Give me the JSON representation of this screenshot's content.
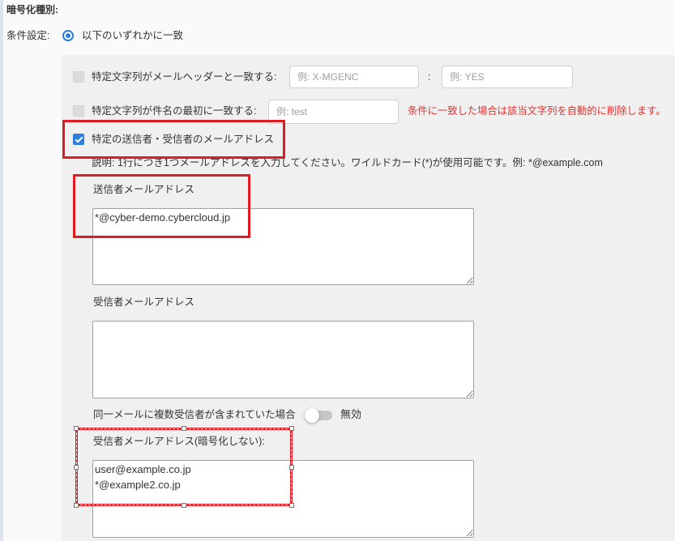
{
  "colors": {
    "accent": "#2d7ee0",
    "note_text": "#e5312f",
    "annotation": "#e01b22",
    "panel_bg": "#f0f0f0",
    "page_bg": "#fafafa",
    "text": "#333333"
  },
  "section": {
    "title": "暗号化種別:"
  },
  "condition": {
    "label": "条件設定:",
    "option_label": "以下のいずれかに一致",
    "option_selected": true
  },
  "rules": {
    "header_match": {
      "checked": false,
      "label": "特定文字列がメールヘッダーと一致する:",
      "header_name": {
        "value": "",
        "placeholder": "例: X-MGENC"
      },
      "separator": ":",
      "header_value": {
        "value": "",
        "placeholder": "例: YES"
      }
    },
    "subject_match": {
      "checked": false,
      "label": "特定文字列が件名の最初に一致する:",
      "prefix": {
        "value": "",
        "placeholder": "例: test"
      },
      "note": "条件に一致した場合は該当文字列を自動的に削除します。"
    },
    "address_match": {
      "checked": true,
      "label": "特定の送信者・受信者のメールアドレス",
      "description": "説明: 1行につき1つメールアドレスを入力してください。ワイルドカード(*)が使用可能です。例: *@example.com",
      "sender": {
        "label": "送信者メールアドレス",
        "value": "*@cyber-demo.cybercloud.jp"
      },
      "recipient": {
        "label": "受信者メールアドレス",
        "value": ""
      },
      "multiple_recipients": {
        "label": "同一メールに複数受信者が含まれていた場合",
        "enabled": false,
        "state_label": "無効"
      },
      "excluded_recipient": {
        "label": "受信者メールアドレス(暗号化しない):",
        "value": "user@example.co.jp\n*@example2.co.jp"
      }
    }
  }
}
